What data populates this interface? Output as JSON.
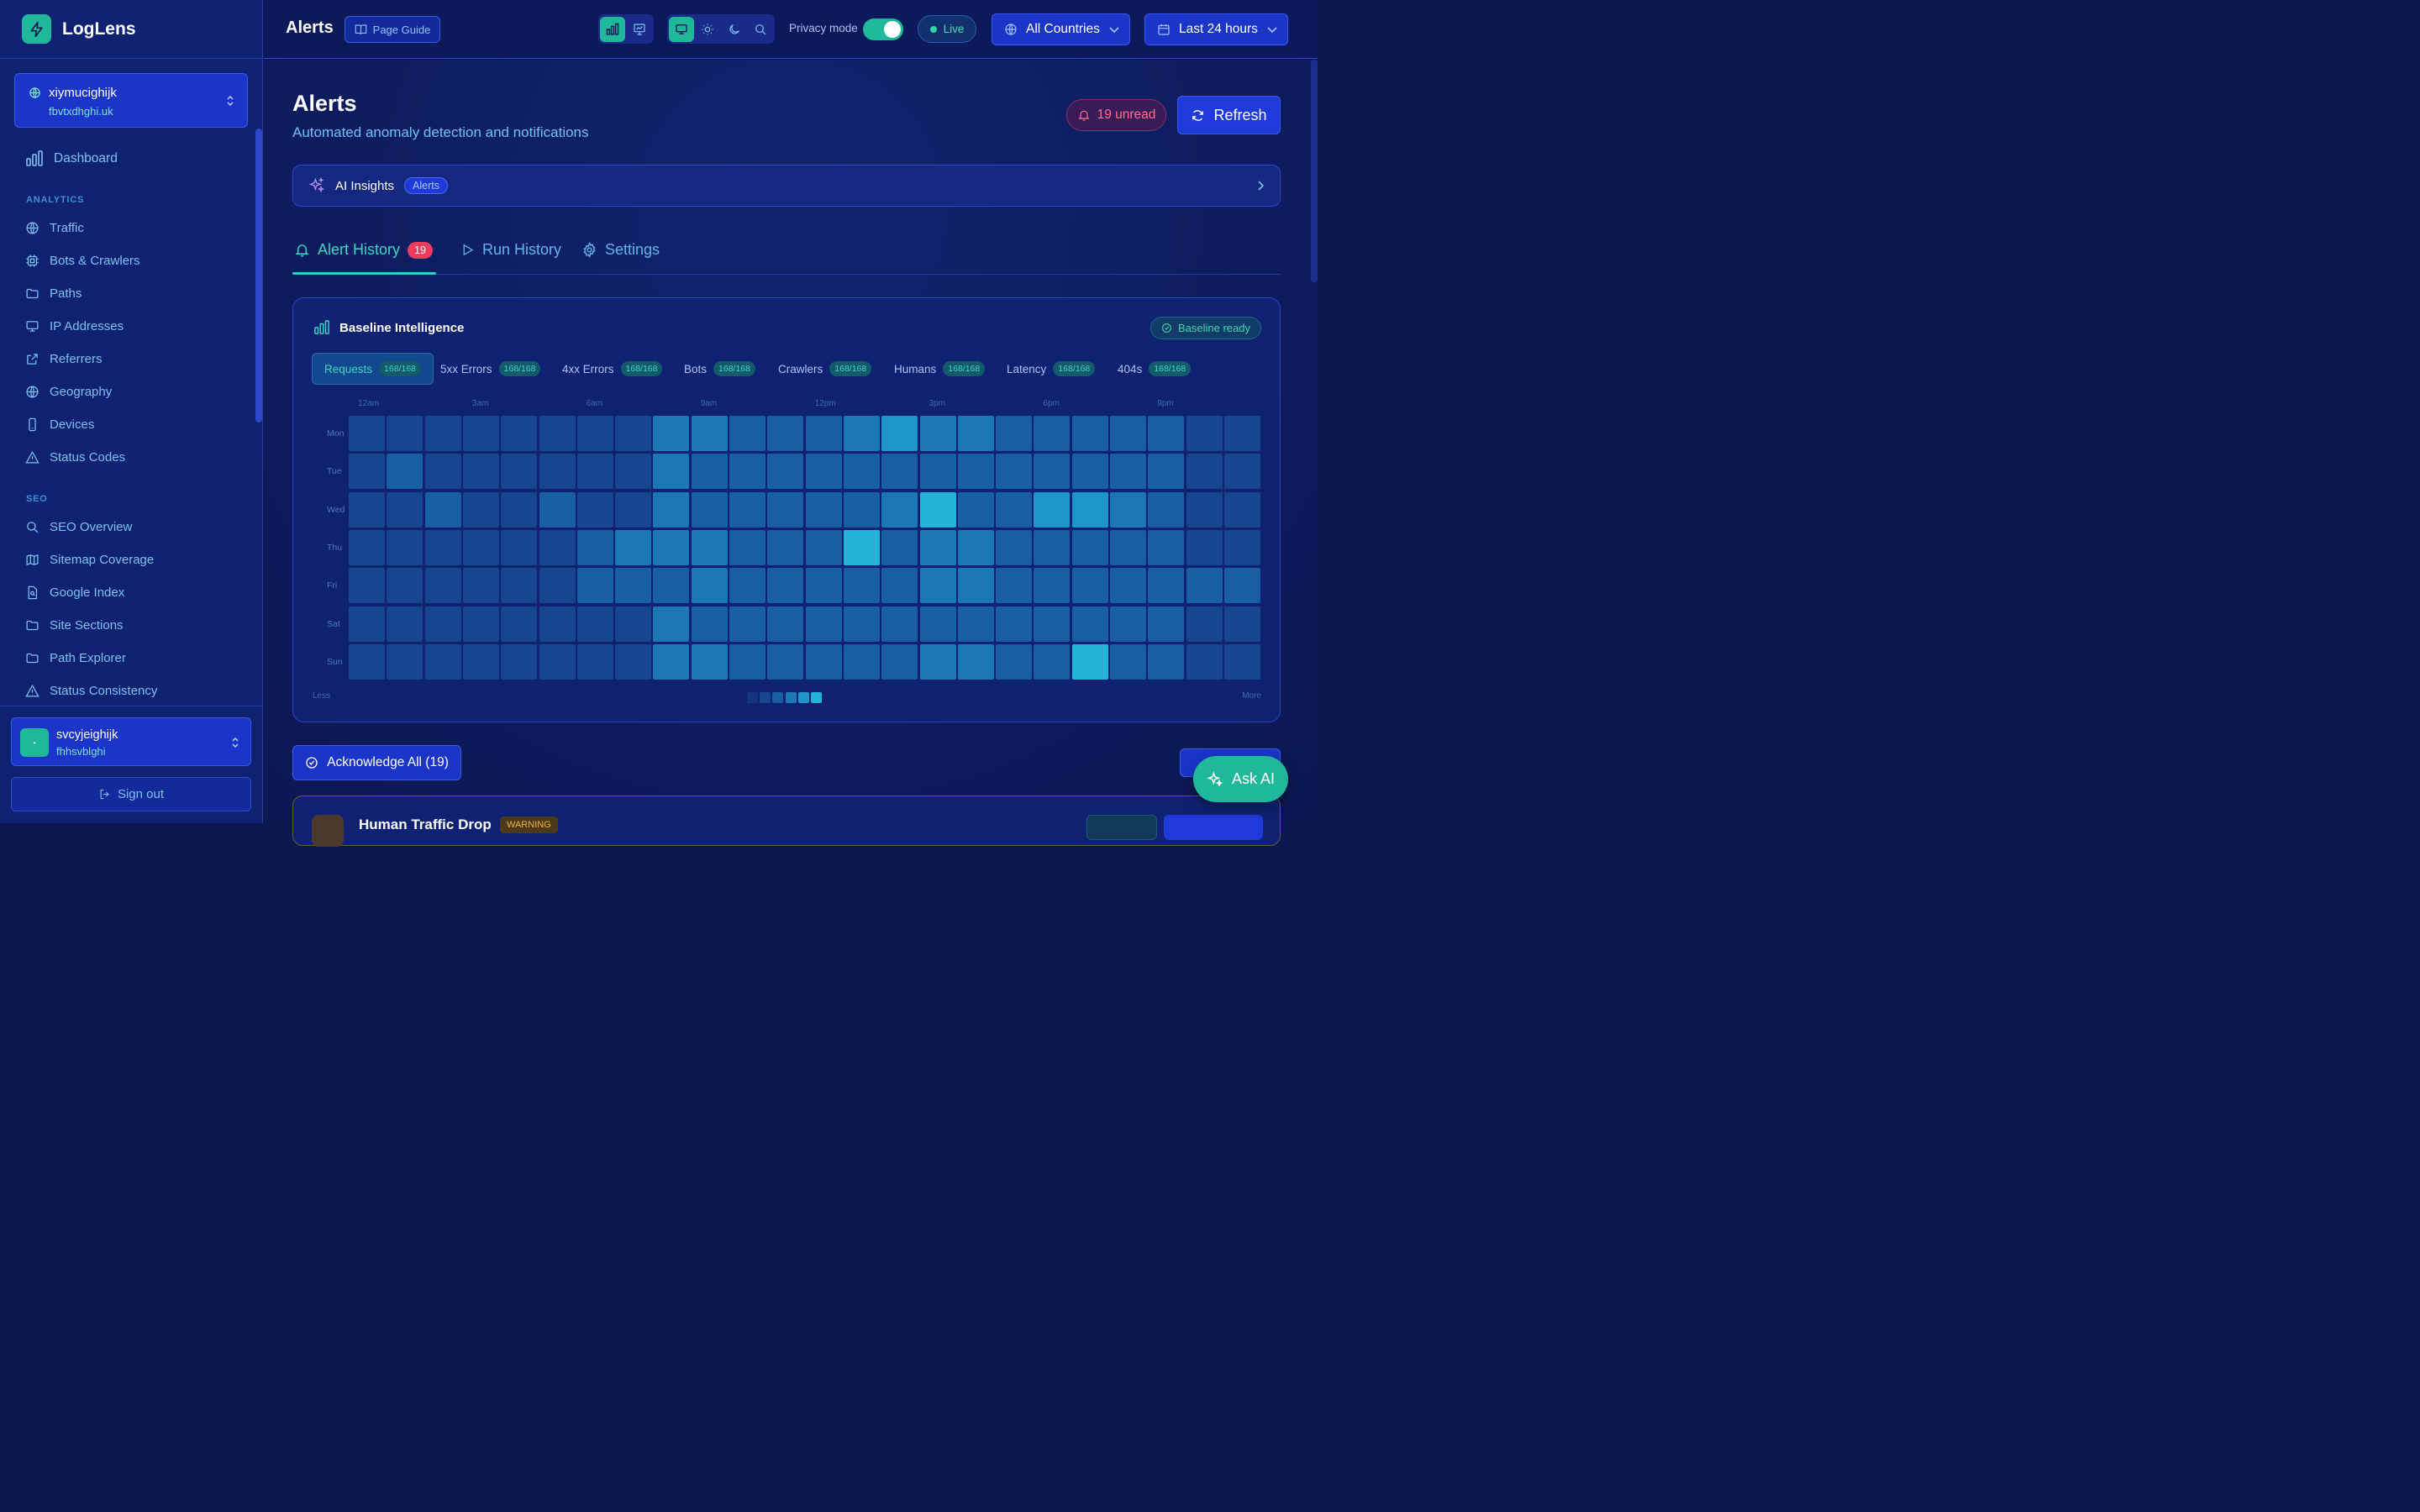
{
  "app": {
    "name": "LogLens"
  },
  "site": {
    "name": "xiymucighijk",
    "domain": "fbvtxdhghi.uk"
  },
  "sidebar": {
    "dashboard": "Dashboard",
    "analytics_label": "ANALYTICS",
    "analytics": [
      "Traffic",
      "Bots & Crawlers",
      "Paths",
      "IP Addresses",
      "Referrers",
      "Geography",
      "Devices",
      "Status Codes"
    ],
    "seo_label": "SEO",
    "seo": [
      "SEO Overview",
      "Sitemap Coverage",
      "Google Index",
      "Site Sections",
      "Path Explorer",
      "Status Consistency"
    ]
  },
  "user": {
    "name": "svcyjeighijk",
    "sub": "fhhsvblghi",
    "avatar": "•"
  },
  "signout": "Sign out",
  "topbar": {
    "title": "Alerts",
    "page_guide": "Page Guide",
    "privacy_label": "Privacy mode",
    "live": "Live",
    "countries": "All Countries",
    "range": "Last 24 hours"
  },
  "page": {
    "title": "Alerts",
    "subtitle": "Automated anomaly detection and notifications",
    "unread": "19 unread",
    "refresh": "Refresh"
  },
  "insights": {
    "label": "AI Insights",
    "badge": "Alerts"
  },
  "tabs": [
    {
      "label": "Alert History",
      "count": "19"
    },
    {
      "label": "Run History"
    },
    {
      "label": "Settings"
    }
  ],
  "baseline": {
    "title": "Baseline Intelligence",
    "status": "Baseline ready",
    "metrics": [
      {
        "label": "Requests",
        "count": "168/168"
      },
      {
        "label": "5xx Errors",
        "count": "168/168"
      },
      {
        "label": "4xx Errors",
        "count": "168/168"
      },
      {
        "label": "Bots",
        "count": "168/168"
      },
      {
        "label": "Crawlers",
        "count": "168/168"
      },
      {
        "label": "Humans",
        "count": "168/168"
      },
      {
        "label": "Latency",
        "count": "168/168"
      },
      {
        "label": "404s",
        "count": "168/168"
      }
    ],
    "hours": [
      "12am",
      "3am",
      "6am",
      "9am",
      "12pm",
      "3pm",
      "6pm",
      "9pm"
    ],
    "days": [
      "Mon",
      "Tue",
      "Wed",
      "Thu",
      "Fri",
      "Sat",
      "Sun"
    ],
    "levels": [
      [
        1,
        1,
        1,
        1,
        1,
        1,
        1,
        1,
        3,
        3,
        2,
        2,
        2,
        3,
        4,
        3,
        3,
        2,
        2,
        2,
        2,
        2,
        1,
        1
      ],
      [
        1,
        2,
        1,
        1,
        1,
        1,
        1,
        1,
        3,
        2,
        2,
        2,
        2,
        2,
        2,
        2,
        2,
        2,
        2,
        2,
        2,
        2,
        1,
        1
      ],
      [
        1,
        1,
        2,
        1,
        1,
        2,
        1,
        1,
        3,
        2,
        2,
        2,
        2,
        2,
        3,
        5,
        2,
        2,
        4,
        4,
        3,
        2,
        1,
        1
      ],
      [
        1,
        1,
        1,
        1,
        1,
        1,
        2,
        3,
        3,
        3,
        2,
        2,
        2,
        5,
        2,
        3,
        3,
        2,
        2,
        2,
        2,
        2,
        1,
        1
      ],
      [
        1,
        1,
        1,
        1,
        1,
        1,
        2,
        2,
        2,
        3,
        2,
        2,
        2,
        2,
        2,
        3,
        3,
        2,
        2,
        2,
        2,
        2,
        2,
        2
      ],
      [
        1,
        1,
        1,
        1,
        1,
        1,
        1,
        1,
        3,
        2,
        2,
        2,
        2,
        2,
        2,
        2,
        2,
        2,
        2,
        2,
        2,
        2,
        1,
        1
      ],
      [
        1,
        1,
        1,
        1,
        1,
        1,
        1,
        1,
        3,
        3,
        2,
        2,
        2,
        2,
        2,
        3,
        3,
        2,
        2,
        5,
        2,
        2,
        1,
        1
      ]
    ],
    "legend_less": "Less",
    "legend_more": "More",
    "palette": [
      "#15347e",
      "#17458e",
      "#195ea0",
      "#1b78b4",
      "#1e96c8",
      "#22b4d8"
    ]
  },
  "actions": {
    "ack_all": "Acknowledge All (19)"
  },
  "peek": {
    "title": "Human Traffic Drop",
    "badge": "WARNING"
  },
  "ask_ai": "Ask AI",
  "colors": {
    "accent": "#1fb89a",
    "primary": "#1f3ad8",
    "danger": "#ef3b5e"
  }
}
